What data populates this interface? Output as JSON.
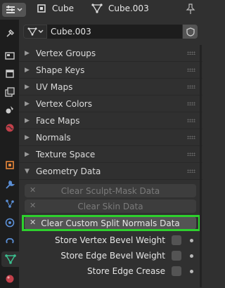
{
  "header": {
    "object_name": "Cube",
    "mesh_name": "Cube.003"
  },
  "datablock": {
    "name": "Cube.003"
  },
  "panels": [
    {
      "label": "Vertex Groups",
      "expanded": false
    },
    {
      "label": "Shape Keys",
      "expanded": false
    },
    {
      "label": "UV Maps",
      "expanded": false
    },
    {
      "label": "Vertex Colors",
      "expanded": false
    },
    {
      "label": "Face Maps",
      "expanded": false
    },
    {
      "label": "Normals",
      "expanded": false
    },
    {
      "label": "Texture Space",
      "expanded": false
    },
    {
      "label": "Geometry Data",
      "expanded": true
    }
  ],
  "geometry": {
    "buttons": [
      {
        "label": "Clear Sculpt-Mask Data",
        "enabled": false
      },
      {
        "label": "Clear Skin Data",
        "enabled": false
      },
      {
        "label": "Clear Custom Split Normals Data",
        "enabled": true
      }
    ],
    "props": [
      {
        "label": "Store Vertex Bevel Weight",
        "checked": false
      },
      {
        "label": "Store Edge Bevel Weight",
        "checked": false
      },
      {
        "label": "Store Edge Crease",
        "checked": false
      }
    ]
  },
  "colors": {
    "highlight": "#2dd12d",
    "active_tab_icon": "#3bbf8f"
  },
  "icons": {
    "tabs": [
      "tool-icon",
      "render-icon",
      "output-icon",
      "view-layer-icon",
      "scene-icon",
      "world-icon",
      "object-icon",
      "modifier-icon",
      "particles-icon",
      "physics-icon",
      "constraints-icon",
      "mesh-data-icon",
      "material-icon"
    ]
  }
}
